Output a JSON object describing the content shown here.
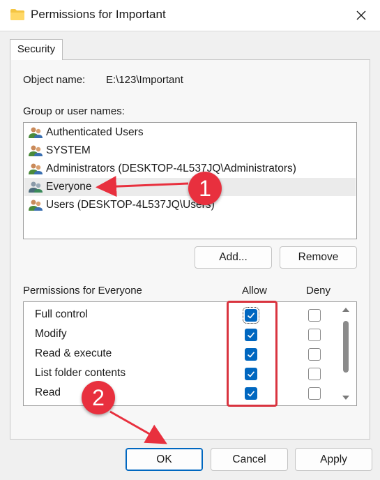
{
  "window": {
    "title": "Permissions for Important",
    "folder_icon": "folder-icon",
    "close_icon": "close-icon"
  },
  "tabs": [
    {
      "label": "Security",
      "active": true
    }
  ],
  "object": {
    "label": "Object name:",
    "value": "E:\\123\\Important"
  },
  "group": {
    "label": "Group or user names:",
    "items": [
      {
        "name": "Authenticated Users",
        "icon": "users-icon",
        "selected": false
      },
      {
        "name": "SYSTEM",
        "icon": "users-icon",
        "selected": false
      },
      {
        "name": "Administrators (DESKTOP-4L537JQ\\Administrators)",
        "icon": "users-icon",
        "selected": false
      },
      {
        "name": "Everyone",
        "icon": "users-icon",
        "selected": true
      },
      {
        "name": "Users (DESKTOP-4L537JQ\\Users)",
        "icon": "users-icon",
        "selected": false
      }
    ],
    "add_button": "Add...",
    "remove_button": "Remove"
  },
  "permissions": {
    "label": "Permissions for Everyone",
    "allow_header": "Allow",
    "deny_header": "Deny",
    "rows": [
      {
        "name": "Full control",
        "allow": true,
        "deny": false
      },
      {
        "name": "Modify",
        "allow": true,
        "deny": false
      },
      {
        "name": "Read & execute",
        "allow": true,
        "deny": false
      },
      {
        "name": "List folder contents",
        "allow": true,
        "deny": false
      },
      {
        "name": "Read",
        "allow": true,
        "deny": false
      }
    ]
  },
  "annotations": {
    "step1": "1",
    "step2": "2",
    "color": "#e8303e"
  },
  "footer": {
    "ok": "OK",
    "cancel": "Cancel",
    "apply": "Apply"
  },
  "colors": {
    "accent": "#0067c0",
    "annotation": "#d9343f"
  }
}
